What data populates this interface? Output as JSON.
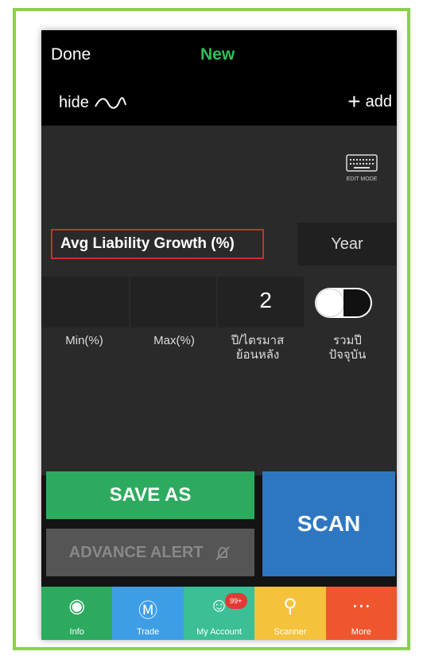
{
  "topbar": {
    "done": "Done",
    "new": "New"
  },
  "hidebar": {
    "hide": "hide",
    "add": "add"
  },
  "keyboard": {
    "label": "EDIT MODE"
  },
  "field": {
    "name": "Avg Liability Growth (%)",
    "period": "Year"
  },
  "inputs": {
    "years_back": "2"
  },
  "labels": {
    "min": "Min(%)",
    "max": "Max(%)",
    "years_back_1": "ปี/ไตรมาส",
    "years_back_2": "ย้อนหลัง",
    "include_current_1": "รวมปี",
    "include_current_2": "ปัจจุบัน"
  },
  "buttons": {
    "save_as": "SAVE AS",
    "advance_alert": "ADVANCE ALERT",
    "scan": "SCAN"
  },
  "tabs": [
    {
      "label": "Info",
      "color": "#2cab5f",
      "icon": "globe-icon"
    },
    {
      "label": "Trade",
      "color": "#3d9ee6",
      "icon": "dollar-icon"
    },
    {
      "label": "My Account",
      "color": "#3cbf97",
      "icon": "user-icon",
      "badge": "99+"
    },
    {
      "label": "Scanner",
      "color": "#f4c23c",
      "icon": "search-icon"
    },
    {
      "label": "More",
      "color": "#f0562e",
      "icon": "more-icon"
    }
  ],
  "colors": {
    "frame": "#8dcf4a",
    "accent_green": "#2fbf57",
    "highlight_red": "#c9302c"
  }
}
